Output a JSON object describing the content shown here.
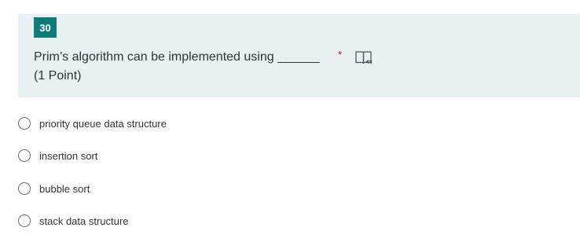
{
  "question": {
    "number": "30",
    "text": "Prim’s algorithm can be implemented using ______",
    "required_marker": "*",
    "points": "(1 Point)",
    "reader_icon": "immersive-reader-icon"
  },
  "options": [
    {
      "label": "priority queue data structure"
    },
    {
      "label": "insertion sort"
    },
    {
      "label": "bubble sort"
    },
    {
      "label": "stack data structure"
    }
  ],
  "colors": {
    "badge": "#0f7b7b",
    "header_bg": "#e9f0f1",
    "required": "#a4262c"
  }
}
